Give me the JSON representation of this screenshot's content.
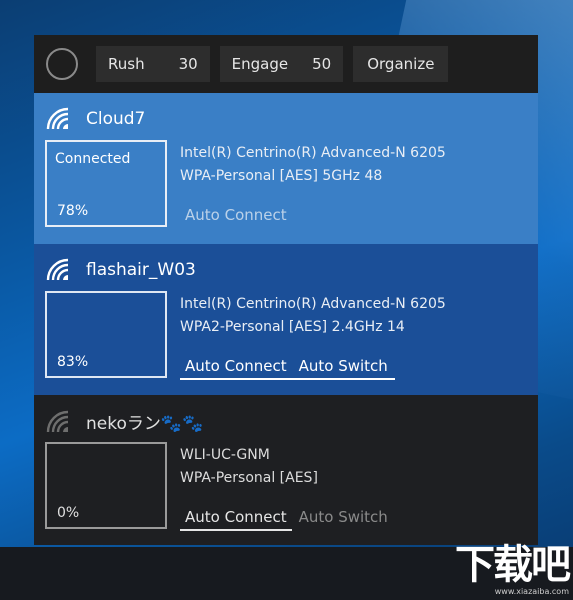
{
  "toolbar": {
    "rush_label": "Rush",
    "rush_value": "30",
    "engage_label": "Engage",
    "engage_value": "50",
    "organize_label": "Organize"
  },
  "networks": [
    {
      "ssid": "Cloud7",
      "status": "Connected",
      "signal": "78%",
      "signal_fraction": 0.78,
      "adapter": "Intel(R) Centrino(R) Advanced-N 6205",
      "security": "WPA-Personal [AES] 5GHz 48",
      "auto_connect": "Auto Connect",
      "auto_connect_on": false,
      "icon": "wifi-signal-icon"
    },
    {
      "ssid": "flashair_W03",
      "status": "",
      "signal": "83%",
      "signal_fraction": 0.83,
      "adapter": "Intel(R) Centrino(R) Advanced-N 6205",
      "security": "WPA2-Personal [AES] 2.4GHz 14",
      "auto_connect": "Auto Connect",
      "auto_switch": "Auto Switch",
      "auto_connect_on": true,
      "auto_switch_on": true,
      "icon": "wifi-signal-icon"
    },
    {
      "ssid": "nekoラン🐾🐾",
      "status": "",
      "signal": "0%",
      "signal_fraction": 0.0,
      "adapter": "WLI-UC-GNM",
      "security": "WPA-Personal [AES]",
      "auto_connect": "Auto Connect",
      "auto_switch": "Auto Switch",
      "auto_connect_on": true,
      "auto_switch_on": false,
      "icon": "wifi-signal-icon"
    }
  ],
  "watermark": {
    "main": "下载吧",
    "url": "www.xiazaiba.com"
  },
  "colors": {
    "selected_row": "#3a7fc6",
    "second_row": "#1b4f98",
    "third_row": "#1e1f22",
    "toolbar": "#1e1e1e"
  }
}
